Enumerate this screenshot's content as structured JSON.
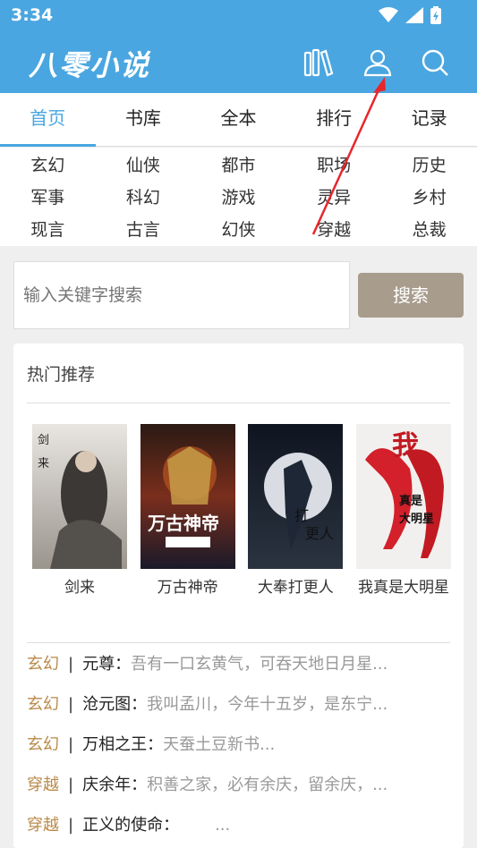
{
  "status": {
    "time": "3:34"
  },
  "app": {
    "title": "八零小说"
  },
  "tabs": [
    {
      "label": "首页",
      "active": true
    },
    {
      "label": "书库"
    },
    {
      "label": "全本"
    },
    {
      "label": "排行"
    },
    {
      "label": "记录"
    }
  ],
  "categories": [
    "玄幻",
    "仙侠",
    "都市",
    "职场",
    "历史",
    "军事",
    "科幻",
    "游戏",
    "灵异",
    "乡村",
    "现言",
    "古言",
    "幻侠",
    "穿越",
    "总裁"
  ],
  "search": {
    "placeholder": "输入关键字搜索",
    "button": "搜索"
  },
  "hot": {
    "title": "热门推荐",
    "books": [
      {
        "title": "剑来",
        "cover_text": "剑来"
      },
      {
        "title": "万古神帝",
        "cover_text": "万古神帝"
      },
      {
        "title": "大奉打更人",
        "cover_text": "打更人"
      },
      {
        "title": "我真是大明星",
        "cover_text": "真是大明星"
      }
    ]
  },
  "list": [
    {
      "tag": "玄幻",
      "name": "元尊：",
      "desc": "吾有一口玄黄气，可吞天地日月星..."
    },
    {
      "tag": "玄幻",
      "name": "沧元图：",
      "desc": "我叫孟川，今年十五岁，是东宁..."
    },
    {
      "tag": "玄幻",
      "name": "万相之王：",
      "desc": "天蚕土豆新书..."
    },
    {
      "tag": "穿越",
      "name": "庆余年：",
      "desc": "积善之家，必有余庆，留余庆，..."
    },
    {
      "tag": "穿越",
      "name": "正义的使命：",
      "desc": "..."
    }
  ],
  "colors": {
    "brand": "#4aa6e0",
    "tag": "#b88a4a",
    "search_button": "#a89c8d"
  }
}
